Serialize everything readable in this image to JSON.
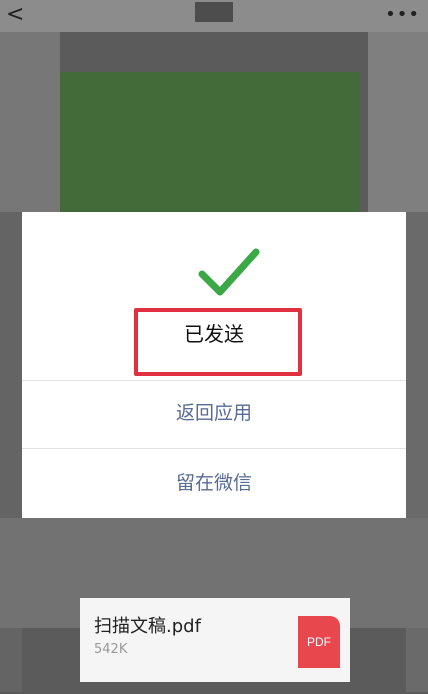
{
  "nav": {
    "back_icon": "chevron-left-icon",
    "more_icon": "more-dots-icon",
    "back_glyph": "<",
    "more_glyph": "•••"
  },
  "dialog": {
    "status_icon": "checkmark-icon",
    "status_text": "已发送",
    "return_label": "返回应用",
    "stay_label": "留在微信",
    "accent_color": "#576b95",
    "check_color": "#3aa845"
  },
  "file": {
    "name": "扫描文稿.pdf",
    "size": "542K",
    "badge": "PDF",
    "badge_color": "#e8474d"
  },
  "annotation": {
    "color": "#e1303f"
  }
}
